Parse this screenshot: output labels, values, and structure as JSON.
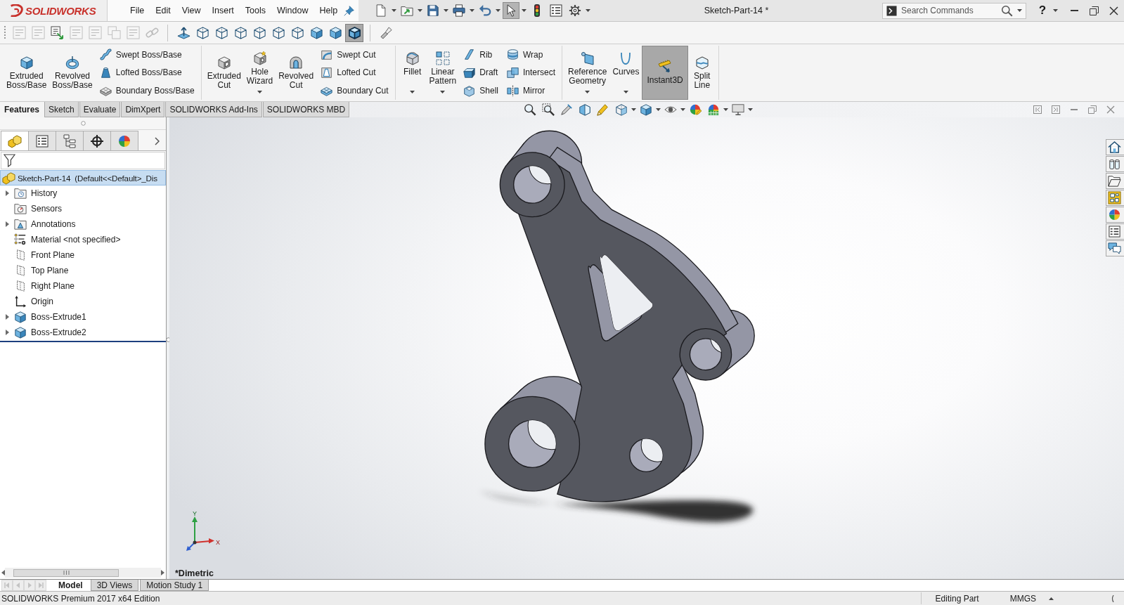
{
  "app": {
    "logo": "SOLIDWORKS"
  },
  "menu": [
    "File",
    "Edit",
    "View",
    "Insert",
    "Tools",
    "Window",
    "Help"
  ],
  "quick_access": [
    {
      "kind": "new",
      "dropdown": true,
      "selected": false
    },
    {
      "kind": "open",
      "dropdown": true,
      "selected": false
    },
    {
      "kind": "save",
      "dropdown": true,
      "selected": false
    },
    {
      "kind": "print",
      "dropdown": true,
      "selected": false
    },
    {
      "kind": "undo",
      "dropdown": true,
      "selected": false
    },
    {
      "kind": "select",
      "dropdown": true,
      "selected": true
    },
    {
      "kind": "rebuild",
      "dropdown": false,
      "selected": false
    },
    {
      "kind": "file-properties",
      "dropdown": false,
      "selected": false
    },
    {
      "kind": "options",
      "dropdown": true,
      "selected": false
    }
  ],
  "window": {
    "title": "Sketch-Part-14 *"
  },
  "search": {
    "placeholder": "Search Commands"
  },
  "help": "?",
  "standard_toolbar": {
    "groups": [
      [
        {
          "kind": "note",
          "disabled": true,
          "selected": false
        },
        {
          "kind": "note",
          "disabled": true,
          "selected": false
        },
        {
          "kind": "note-arrow",
          "disabled": false,
          "selected": false
        },
        {
          "kind": "note",
          "disabled": true,
          "selected": false
        },
        {
          "kind": "note",
          "disabled": true,
          "selected": false
        },
        {
          "kind": "pages",
          "disabled": true,
          "selected": false
        },
        {
          "kind": "note",
          "disabled": true,
          "selected": false
        },
        {
          "kind": "chain",
          "disabled": true,
          "selected": false
        }
      ],
      [
        {
          "kind": "normal-to",
          "disabled": false,
          "selected": false
        },
        {
          "kind": "wire-cube",
          "disabled": false,
          "selected": false
        },
        {
          "kind": "wire-cube",
          "disabled": false,
          "selected": false
        },
        {
          "kind": "wire-cube",
          "disabled": false,
          "selected": false
        },
        {
          "kind": "wire-cube",
          "disabled": false,
          "selected": false
        },
        {
          "kind": "wire-cube",
          "disabled": false,
          "selected": false
        },
        {
          "kind": "wire-cube",
          "disabled": false,
          "selected": false
        },
        {
          "kind": "shaded-cube",
          "disabled": false,
          "selected": false
        },
        {
          "kind": "shaded-cube",
          "disabled": false,
          "selected": false
        },
        {
          "kind": "shaded-edges",
          "disabled": false,
          "selected": true
        }
      ],
      [
        {
          "kind": "flashlight",
          "disabled": false,
          "selected": false
        }
      ]
    ]
  },
  "ribbon": {
    "groups": [
      {
        "large": [
          {
            "kind": "extruded-boss",
            "label": "Extruded Boss/Base",
            "dropdown": false,
            "selected": false
          },
          {
            "kind": "revolved-boss",
            "label": "Revolved Boss/Base",
            "dropdown": false,
            "selected": false
          }
        ],
        "stacks": [
          [
            {
              "kind": "swept-boss",
              "label": "Swept Boss/Base"
            },
            {
              "kind": "lofted-boss",
              "label": "Lofted Boss/Base"
            },
            {
              "kind": "boundary-boss",
              "label": "Boundary Boss/Base"
            }
          ]
        ]
      },
      {
        "large": [
          {
            "kind": "extruded-cut",
            "label": "Extruded Cut",
            "dropdown": false,
            "selected": false
          },
          {
            "kind": "hole-wizard",
            "label": "Hole Wizard",
            "dropdown": true,
            "selected": false
          },
          {
            "kind": "revolved-cut",
            "label": "Revolved Cut",
            "dropdown": false,
            "selected": false
          }
        ],
        "stacks": [
          [
            {
              "kind": "swept-cut",
              "label": "Swept Cut"
            },
            {
              "kind": "lofted-cut",
              "label": "Lofted Cut"
            },
            {
              "kind": "boundary-cut",
              "label": "Boundary Cut"
            }
          ]
        ]
      },
      {
        "large": [
          {
            "kind": "fillet",
            "label": "Fillet",
            "dropdown": true,
            "selected": false
          },
          {
            "kind": "linear-pattern",
            "label": "Linear Pattern",
            "dropdown": true,
            "selected": false
          }
        ],
        "stacks": [
          [
            {
              "kind": "rib",
              "label": "Rib"
            },
            {
              "kind": "draft",
              "label": "Draft"
            },
            {
              "kind": "shell",
              "label": "Shell"
            }
          ],
          [
            {
              "kind": "wrap",
              "label": "Wrap"
            },
            {
              "kind": "intersect",
              "label": "Intersect"
            },
            {
              "kind": "mirror",
              "label": "Mirror"
            }
          ]
        ]
      },
      {
        "large": [
          {
            "kind": "reference-geometry",
            "label": "Reference Geometry",
            "dropdown": true,
            "selected": false
          },
          {
            "kind": "curves",
            "label": "Curves",
            "dropdown": true,
            "selected": false
          },
          {
            "kind": "instant3d",
            "label": "Instant3D",
            "dropdown": false,
            "selected": true
          },
          {
            "kind": "split-line",
            "label": "Split Line",
            "dropdown": false,
            "selected": false
          }
        ]
      }
    ]
  },
  "command_tabs": [
    {
      "label": "Features",
      "selected": true
    },
    {
      "label": "Sketch",
      "selected": false
    },
    {
      "label": "Evaluate",
      "selected": false
    },
    {
      "label": "DimXpert",
      "selected": false
    },
    {
      "label": "SOLIDWORKS Add-Ins",
      "selected": false
    },
    {
      "label": "SOLIDWORKS MBD",
      "selected": false
    }
  ],
  "panel_tabs": [
    {
      "kind": "features",
      "selected": true
    },
    {
      "kind": "properties",
      "selected": false
    },
    {
      "kind": "configurations",
      "selected": false
    },
    {
      "kind": "dimxpert",
      "selected": false
    },
    {
      "kind": "display",
      "selected": false
    }
  ],
  "tree": {
    "root": {
      "label": "Sketch-Part-14  (Default<<Default>_Dis",
      "selected": true
    },
    "items": [
      {
        "kind": "history",
        "label": "History",
        "expandable": true
      },
      {
        "kind": "sensors",
        "label": "Sensors",
        "expandable": false
      },
      {
        "kind": "annotations",
        "label": "Annotations",
        "expandable": true
      },
      {
        "kind": "material",
        "label": "Material <not specified>",
        "expandable": false
      },
      {
        "kind": "plane",
        "label": "Front Plane",
        "expandable": false
      },
      {
        "kind": "plane",
        "label": "Top Plane",
        "expandable": false
      },
      {
        "kind": "plane",
        "label": "Right Plane",
        "expandable": false
      },
      {
        "kind": "origin",
        "label": "Origin",
        "expandable": false
      },
      {
        "kind": "feature",
        "label": "Boss-Extrude1",
        "expandable": true
      },
      {
        "kind": "feature",
        "label": "Boss-Extrude2",
        "expandable": true
      }
    ]
  },
  "viewport": {
    "view_name": "*Dimetric",
    "triad": {
      "y_label": "Y",
      "x_label": "X"
    }
  },
  "tab_navigation": [
    {
      "kind": "first",
      "disabled": true
    },
    {
      "kind": "previous",
      "disabled": true
    },
    {
      "kind": "next",
      "disabled": true
    },
    {
      "kind": "last",
      "disabled": true
    }
  ],
  "bottom_tabs": [
    {
      "label": "Model",
      "selected": true
    },
    {
      "label": "3D Views",
      "selected": false
    },
    {
      "label": "Motion Study 1",
      "selected": false
    }
  ],
  "status_bar": {
    "edition": "SOLIDWORKS Premium 2017 x64 Edition",
    "mode": "Editing Part",
    "units": "MMGS"
  }
}
